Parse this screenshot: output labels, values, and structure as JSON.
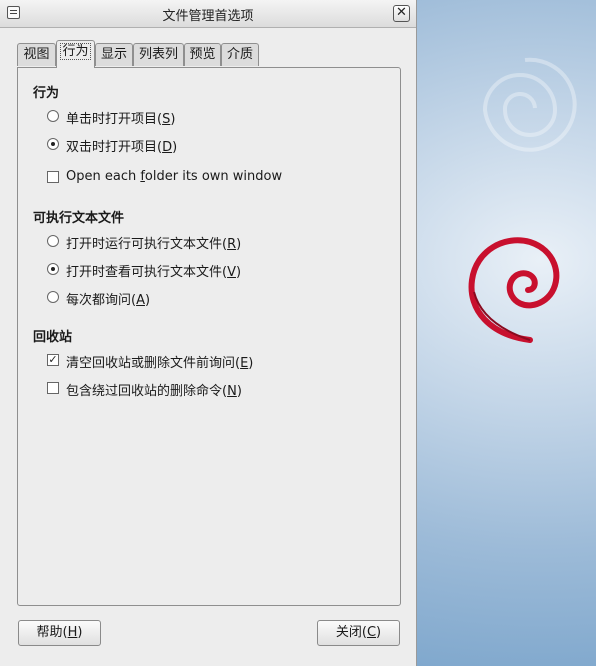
{
  "window": {
    "title": "文件管理首选项",
    "close_glyph": "✕"
  },
  "tabs": [
    {
      "label": "视图"
    },
    {
      "label": "行为"
    },
    {
      "label": "显示"
    },
    {
      "label": "列表列"
    },
    {
      "label": "预览"
    },
    {
      "label": "介质"
    }
  ],
  "active_tab": "行为",
  "behavior": {
    "heading": "行为",
    "single_click": {
      "pre": "单击时打开项目(",
      "key": "S",
      "post": ")",
      "selected": false
    },
    "double_click": {
      "pre": "双击时打开项目(",
      "key": "D",
      "post": ")",
      "selected": true
    },
    "own_window": {
      "pre": "Open each ",
      "key": "f",
      "post": "older its own window",
      "checked": false
    }
  },
  "executable": {
    "heading": "可执行文本文件",
    "run": {
      "pre": "打开时运行可执行文本文件(",
      "key": "R",
      "post": ")",
      "selected": false
    },
    "view": {
      "pre": "打开时查看可执行文本文件(",
      "key": "V",
      "post": ")",
      "selected": true
    },
    "ask": {
      "pre": "每次都询问(",
      "key": "A",
      "post": ")",
      "selected": false
    }
  },
  "trash": {
    "heading": "回收站",
    "confirm": {
      "pre": "清空回收站或删除文件前询问(",
      "key": "E",
      "post": ")",
      "checked": true
    },
    "include_delete": {
      "pre": "包含绕过回收站的删除命令(",
      "key": "N",
      "post": ")",
      "checked": false
    }
  },
  "buttons": {
    "help": {
      "pre": "帮助(",
      "key": "H",
      "post": ")"
    },
    "close": {
      "pre": "关闭(",
      "key": "C",
      "post": ")"
    }
  },
  "colors": {
    "swirl": "#c8102e"
  }
}
